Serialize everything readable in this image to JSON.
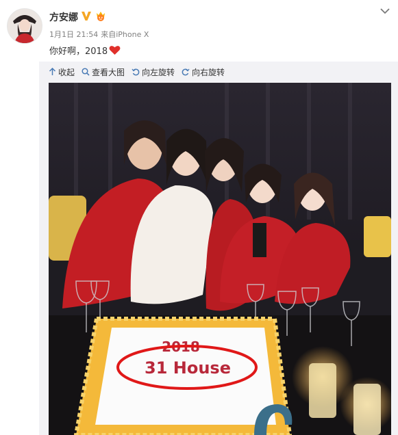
{
  "post": {
    "username": "方安娜",
    "date": "1月1日 21:54",
    "source_prefix": "来自",
    "source": "iPhone X",
    "text": "你好啊，2018"
  },
  "toolbar": {
    "collapse_label": "收起",
    "view_large_label": "查看大图",
    "rotate_left_label": "向左旋转",
    "rotate_right_label": "向右旋转"
  },
  "photo": {
    "cake_year": "2018",
    "cake_text": "31 House"
  },
  "colors": {
    "link_blue": "#4a7bb5",
    "verified_orange": "#f5a623",
    "heart_red": "#e0302b",
    "circle_red": "#e01818"
  },
  "icons": [
    "avatar",
    "verified-icon",
    "vip-icon",
    "heart-icon",
    "chevron-down-icon",
    "collapse-icon",
    "view-large-icon",
    "rotate-left-icon",
    "rotate-right-icon"
  ]
}
